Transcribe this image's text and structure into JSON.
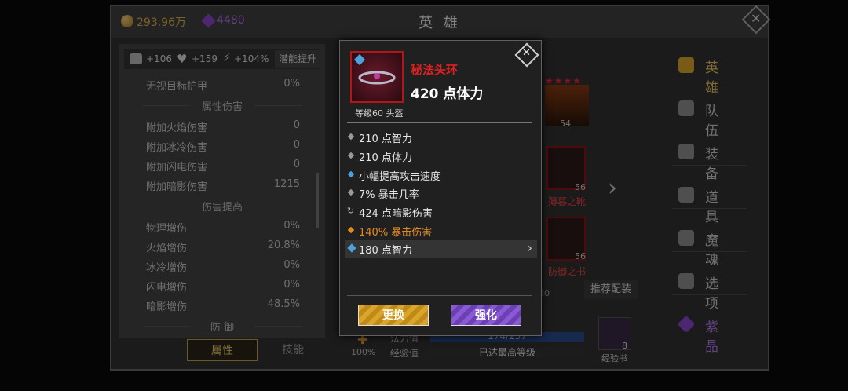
{
  "header": {
    "gold": "293.96万",
    "gems": "4480",
    "title": "英 雄"
  },
  "stats_panel": {
    "attack": "+106",
    "health": "+159",
    "speed": "+104%",
    "upgrade_label": "潜能提升",
    "rows_top": [
      {
        "label": "无视目标护甲",
        "value": "0%"
      }
    ],
    "section_damage": "属性伤害",
    "rows_damage": [
      {
        "label": "附加火焰伤害",
        "value": "0"
      },
      {
        "label": "附加冰冷伤害",
        "value": "0"
      },
      {
        "label": "附加闪电伤害",
        "value": "0"
      },
      {
        "label": "附加暗影伤害",
        "value": "1215"
      }
    ],
    "section_boost": "伤害提高",
    "rows_boost": [
      {
        "label": "物理增伤",
        "value": "0%"
      },
      {
        "label": "火焰增伤",
        "value": "20.8%"
      },
      {
        "label": "冰冷增伤",
        "value": "0%"
      },
      {
        "label": "闪电增伤",
        "value": "0%"
      },
      {
        "label": "暗影增伤",
        "value": "48.5%"
      }
    ],
    "section_defense": "防 御"
  },
  "tabs": {
    "attributes": "属性",
    "skills": "技能"
  },
  "popup": {
    "item_name": "秘法头环",
    "main_stat": "420 点体力",
    "level_slot": "等级60 头盔",
    "lines": [
      {
        "text": "210 点智力",
        "color": "#9a9a9a",
        "text_color": "#e6e6e6"
      },
      {
        "text": "210 点体力",
        "color": "#9a9a9a",
        "text_color": "#e6e6e6"
      },
      {
        "text": "小幅提高攻击速度",
        "color": "#4aa3df",
        "text_color": "#e6e6e6"
      },
      {
        "text": "7% 暴击几率",
        "color": "#9a9a9a",
        "text_color": "#e6e6e6"
      },
      {
        "text": "424 点暗影伤害",
        "color": "#9a9a9a",
        "text_color": "#e6e6e6"
      },
      {
        "text": "140% 暴击伤害",
        "color": "#e08a1e",
        "text_color": "#e08a1e"
      },
      {
        "text": "180 点智力",
        "color": "#4aa3df",
        "text_color": "#e6e6e6"
      }
    ],
    "replace_label": "更换",
    "enhance_label": "强化"
  },
  "hero_area": {
    "hero_level": "54",
    "boots_level": "56",
    "boots_name": "薄暮之靴",
    "book_level": "56",
    "book_name": "防御之书",
    "recommend_label": "推荐配装",
    "mana_label": "法力值",
    "mana_value": "174/237",
    "exp_label": "经验值",
    "exp_value": "已达最高等级",
    "percent": "100%",
    "level_hint": "60",
    "exp_book_count": "8",
    "exp_book_label": "经验书"
  },
  "nav": [
    {
      "label": "英 雄",
      "icon": "heroes-icon"
    },
    {
      "label": "队 伍",
      "icon": "flag-icon"
    },
    {
      "label": "装 备",
      "icon": "helmet-icon"
    },
    {
      "label": "道 具",
      "icon": "bag-icon"
    },
    {
      "label": "魔 魂",
      "icon": "flame-icon"
    },
    {
      "label": "选 项",
      "icon": "gear-icon"
    },
    {
      "label": "紫 晶",
      "icon": "crystal-icon"
    }
  ],
  "colors": {
    "accent_gold": "#d9a62a",
    "accent_purple": "#7c4cc4",
    "item_red": "#e02020"
  }
}
